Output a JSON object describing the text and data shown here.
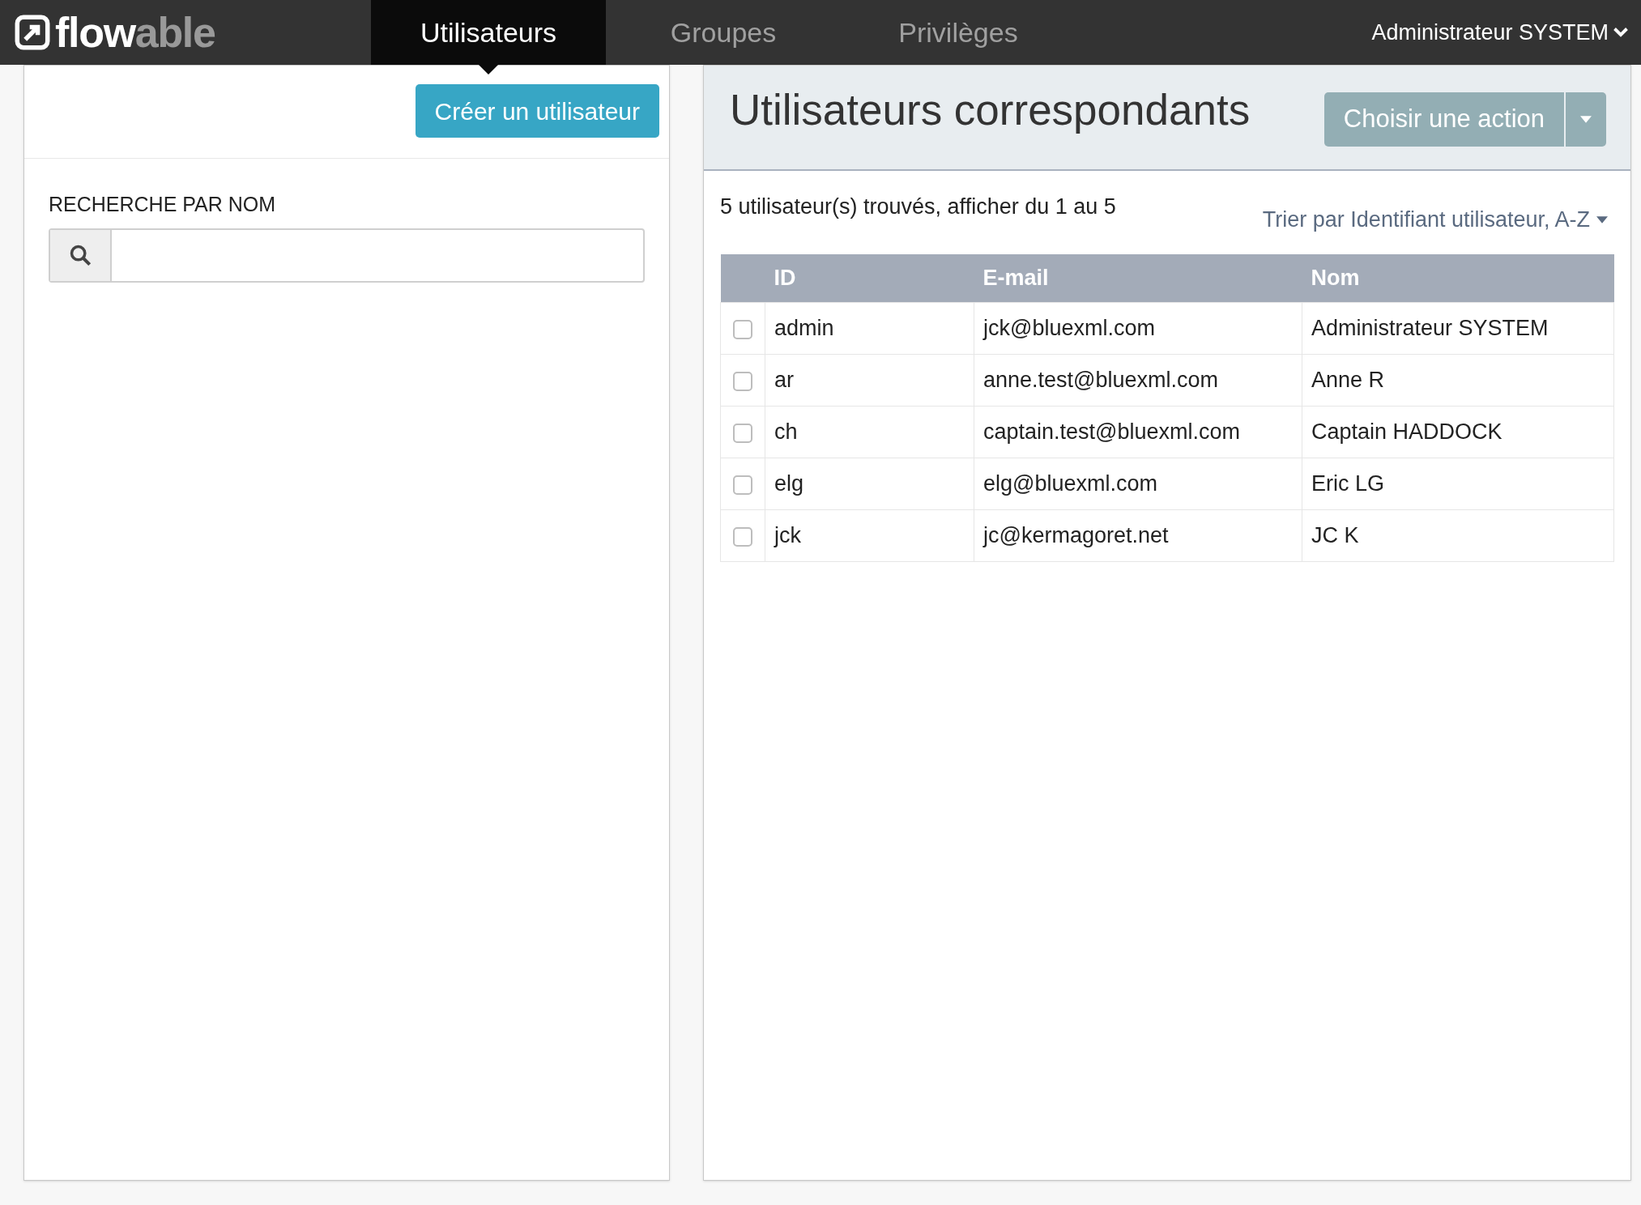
{
  "navbar": {
    "logo": {
      "text_light": "flow",
      "text_dark": "able"
    },
    "tabs": [
      {
        "label": "Utilisateurs",
        "selected": true
      },
      {
        "label": "Groupes",
        "selected": false
      },
      {
        "label": "Privilèges",
        "selected": false
      }
    ],
    "user_menu": "Administrateur SYSTEM"
  },
  "left_panel": {
    "create_button": "Créer un utilisateur",
    "search_label": "RECHERCHE PAR NOM"
  },
  "right_panel": {
    "title": "Utilisateurs correspondants",
    "action_button": "Choisir une action",
    "summary": "5 utilisateur(s) trouvés, afficher du 1 au 5",
    "sort": "Trier par Identifiant utilisateur, A-Z",
    "table": {
      "columns": [
        "ID",
        "E-mail",
        "Nom"
      ],
      "rows": [
        {
          "checked": false,
          "cells": [
            "admin",
            "jck@bluexml.com",
            "Administrateur SYSTEM"
          ]
        },
        {
          "checked": false,
          "cells": [
            "ar",
            "anne.test@bluexml.com",
            "Anne R"
          ]
        },
        {
          "checked": false,
          "cells": [
            "ch",
            "captain.test@bluexml.com",
            "Captain HADDOCK"
          ]
        },
        {
          "checked": false,
          "cells": [
            "elg",
            "elg@bluexml.com",
            "Eric LG"
          ]
        },
        {
          "checked": false,
          "cells": [
            "jck",
            "jc@kermagoret.net",
            "JC K"
          ]
        }
      ]
    }
  }
}
